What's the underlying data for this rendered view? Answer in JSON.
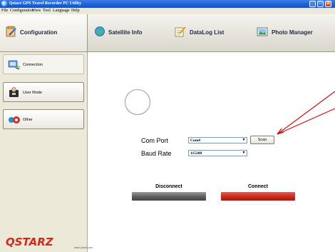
{
  "window": {
    "title": "Qstarz GPS Travel Recorder PC Utility",
    "controls": {
      "minimize": "_",
      "maximize": "□",
      "close": "X"
    }
  },
  "menu": [
    "File",
    "Configuration",
    "View",
    "Tool",
    "Language",
    "Help"
  ],
  "tabs": [
    {
      "label": "Configuration",
      "icon": "configuration-icon",
      "active": true
    },
    {
      "label": "Satellite Info",
      "icon": "satellite-icon"
    },
    {
      "label": "DataLog List",
      "icon": "datalog-icon"
    },
    {
      "label": "Photo Manager",
      "icon": "photo-icon"
    }
  ],
  "sidebar": {
    "items": [
      {
        "label": "Connection",
        "icon": "connection-icon",
        "active": true
      },
      {
        "label": "User Mode",
        "icon": "user-mode-icon"
      },
      {
        "label": "Other",
        "icon": "other-icon"
      }
    ],
    "logo": {
      "text": "QSTARZ",
      "url": "www.Qstarz.com"
    }
  },
  "connection": {
    "com_port_label": "Com Port",
    "com_port_value": "Com4",
    "baud_rate_label": "Baud Rate",
    "baud_rate_value": "115200",
    "scan_label": "Scan",
    "disconnect_label": "Disconnect",
    "connect_label": "Connect"
  },
  "colors": {
    "titlebar": "#1f5fd4",
    "connect": "#c72a1c",
    "disconnect": "#5e5e5e",
    "annotation_arrow": "#d01010",
    "logo": "#d8281b"
  }
}
